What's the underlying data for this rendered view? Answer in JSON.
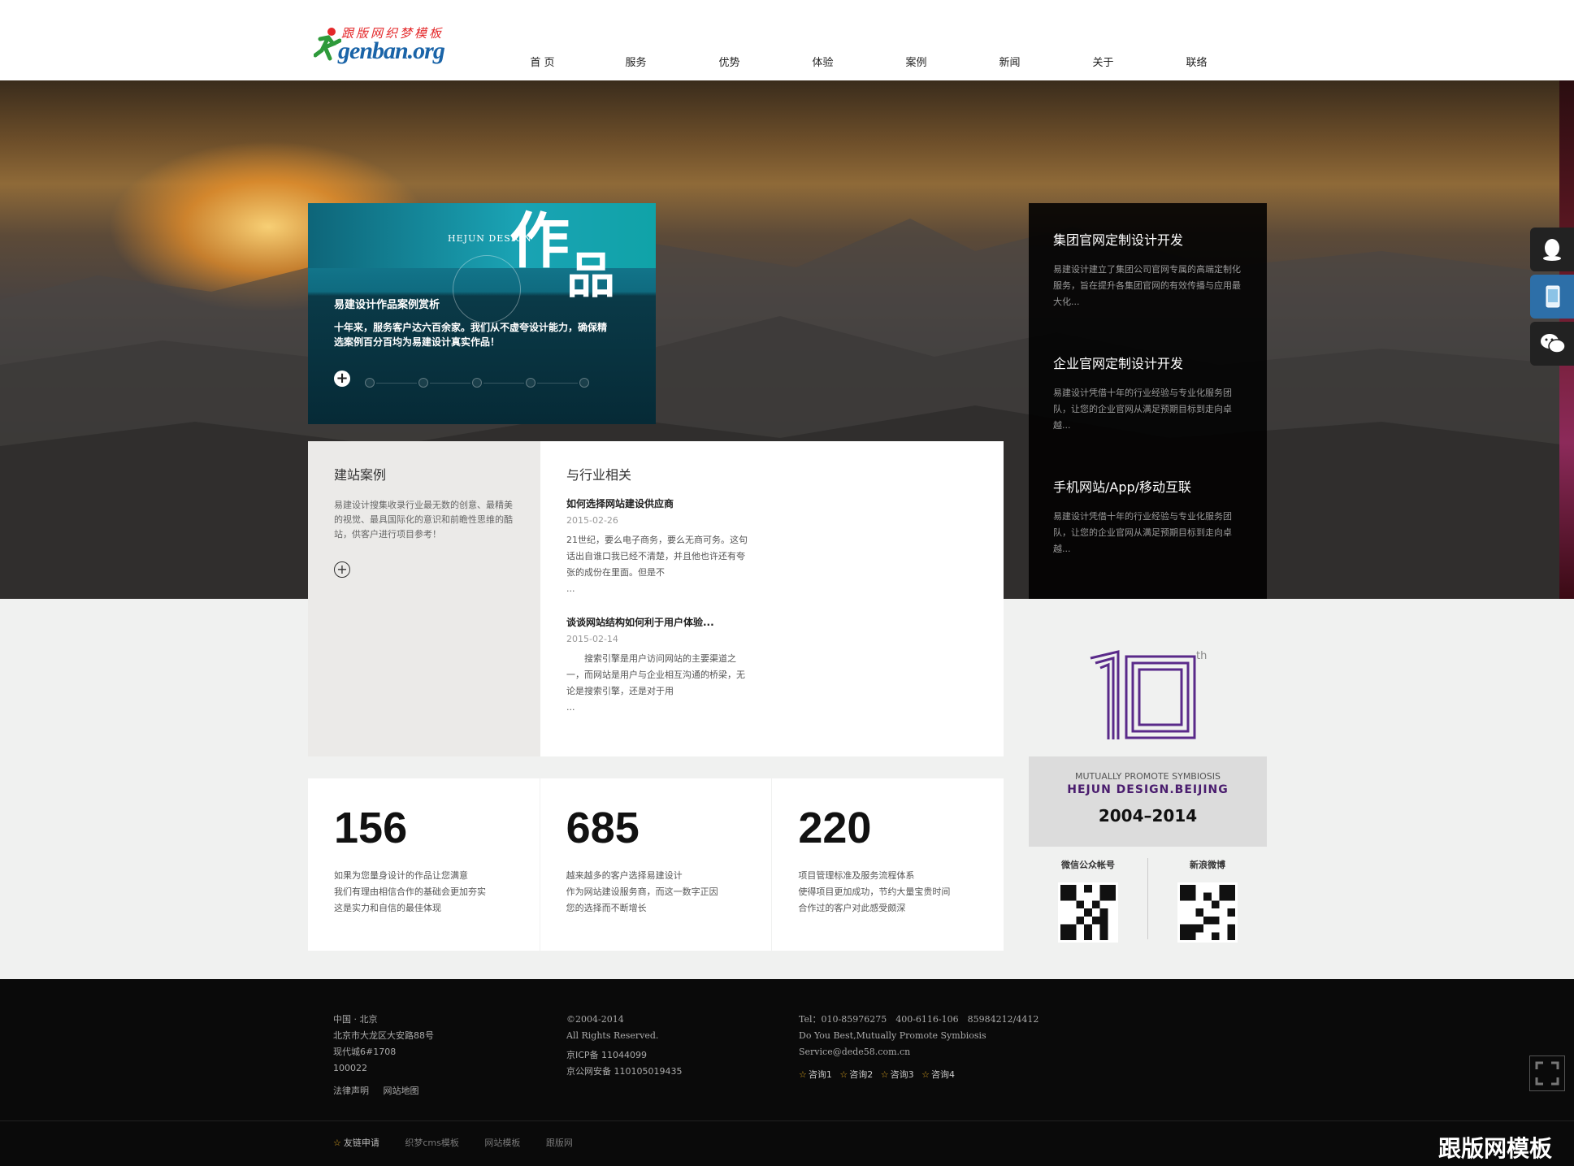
{
  "logo": {
    "cn": "跟版网织梦模板",
    "en": "genban.org"
  },
  "nav": [
    "首 页",
    "服务",
    "优势",
    "体验",
    "案例",
    "新闻",
    "关于",
    "联络"
  ],
  "works": {
    "brand": "HEJUN DESIGN",
    "big_char_1": "作",
    "big_char_2": "品",
    "title": "易建设计作品案例赏析",
    "desc": "十年来，服务客户达六百余家。我们从不虚夸设计能力，确保精选案例百分百均为易建设计真实作品！"
  },
  "services": [
    {
      "title": "集团官网定制设计开发",
      "desc": "易建设计建立了集团公司官网专属的高端定制化服务，旨在提升各集团官网的有效传播与应用最大化..."
    },
    {
      "title": "企业官网定制设计开发",
      "desc": "易建设计凭借十年的行业经验与专业化服务团队，让您的企业官网从满足预期目标到走向卓越..."
    },
    {
      "title": "手机网站/App/移动互联",
      "desc": "易建设计凭借十年的行业经验与专业化服务团队，让您的企业官网从满足预期目标到走向卓越..."
    }
  ],
  "cases": {
    "title": "建站案例",
    "desc": "易建设计搜集收录行业最无数的创意、最精美的视觉、最具国际化的意识和前瞻性思维的酷站，供客户进行项目参考！"
  },
  "news": {
    "title": "与行业相关",
    "items": [
      {
        "title": "如何选择网站建设供应商",
        "date": "2015-02-26",
        "excerpt": "21世纪，要么电子商务，要么无商可务。这句话出自谁口我已经不清楚，并且他也许还有夸张的成份在里面。但是不",
        "more": "..."
      },
      {
        "title": "谈谈网站结构如何利于用户体验...",
        "date": "2015-02-14",
        "excerpt": "　　搜索引擎是用户访问网站的主要渠道之一，而网站是用户与企业相互沟通的桥梁，无论是搜索引擎，还是对于用",
        "more": "..."
      }
    ]
  },
  "stats": [
    {
      "num": "156",
      "lines": [
        "如果为您量身设计的作品让您满意",
        "我们有理由相信合作的基础会更加夯实",
        "这是实力和自信的最佳体现"
      ]
    },
    {
      "num": "685",
      "lines": [
        "越来越多的客户选择易建设计",
        "作为网站建设服务商，而这一数字正因",
        "您的选择而不断增长"
      ]
    },
    {
      "num": "220",
      "lines": [
        "项目管理标准及服务流程体系",
        "使得项目更加成功，节约大量宝贵时间",
        "合作过的客户对此感受颇深"
      ]
    }
  ],
  "tenth": {
    "sup": "th",
    "line1": "MUTUALLY PROMOTE SYMBIOSIS",
    "line2": "HEJUN DESIGN.BEIJING",
    "years": "2004–2014"
  },
  "qr": {
    "wechat": "微信公众帐号",
    "weibo": "新浪微博"
  },
  "footer": {
    "addr": [
      "中国 · 北京",
      "北京市大龙区大安路88号",
      "现代城6#1708",
      "100022"
    ],
    "legal": "法律声明",
    "sitemap": "网站地图",
    "copy": [
      "©2004-2014",
      "All Rights Reserved."
    ],
    "icp": [
      "京ICP备 11044099",
      "京公网安备 110105019435"
    ],
    "contact": [
      "Tel：010-85976275　400-6116-106　85984212/4412",
      "Do You Best,Mutually Promote Symbiosis",
      "Service@dede58.com.cn"
    ],
    "consult": [
      "咨询1",
      "咨询2",
      "咨询3",
      "咨询4"
    ],
    "bottom_links": [
      "友链申请",
      "织梦cms模板",
      "网站模板",
      "跟版网"
    ],
    "watermark": "跟版网模板"
  },
  "colors": {
    "accent_purple": "#4a1d6e",
    "footer_bg": "#0a0a0a"
  }
}
